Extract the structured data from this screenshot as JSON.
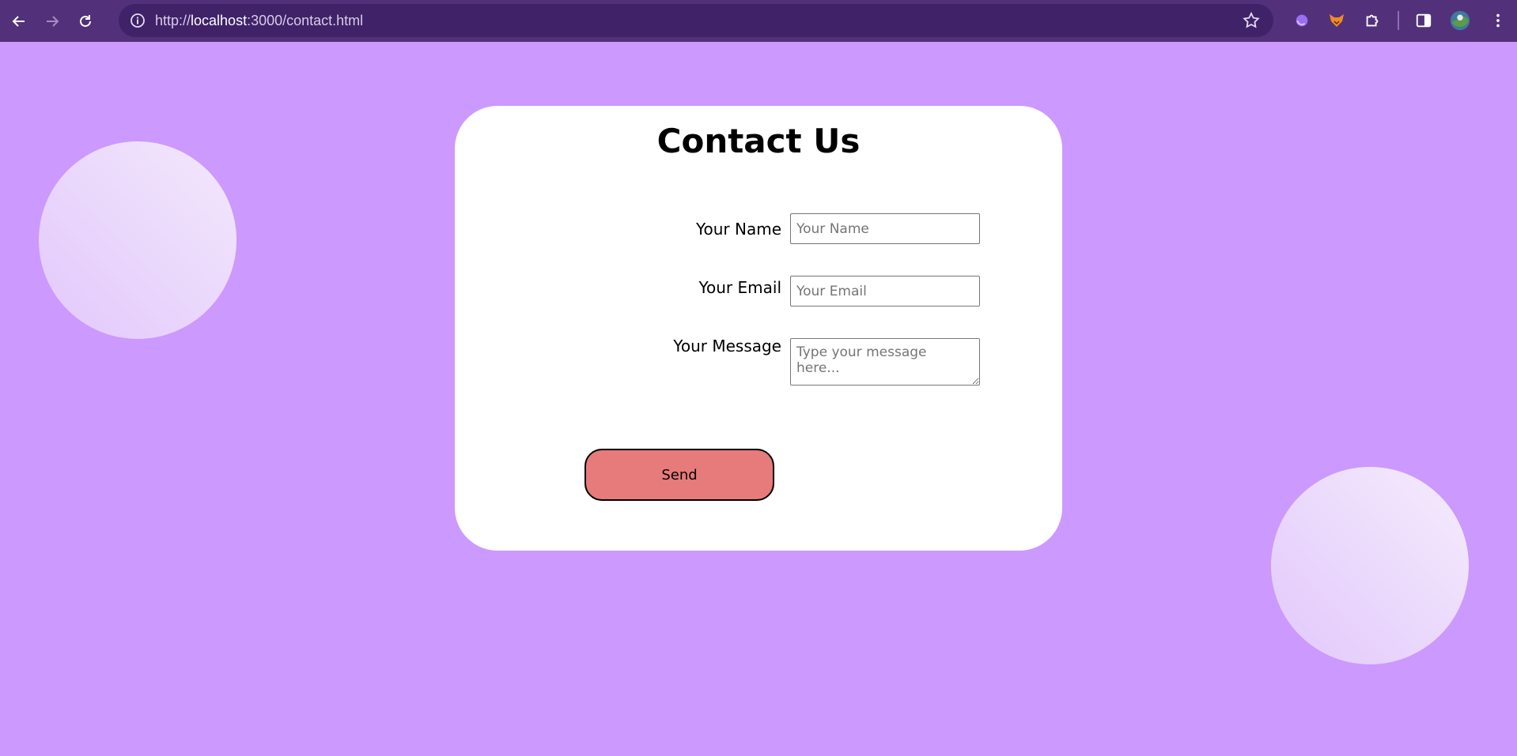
{
  "browser": {
    "url_scheme": "http://",
    "url_host": "localhost",
    "url_rest": ":3000/contact.html"
  },
  "contact": {
    "title": "Contact Us",
    "name_label": "Your Name",
    "name_placeholder": "Your Name",
    "email_label": "Your Email",
    "email_placeholder": "Your Email",
    "message_label": "Your Message",
    "message_placeholder": "Type your message here...",
    "send_label": "Send"
  },
  "colors": {
    "page_background": "#cc99ff",
    "toolbar": "#52317a",
    "send_button": "#e77b7b"
  }
}
